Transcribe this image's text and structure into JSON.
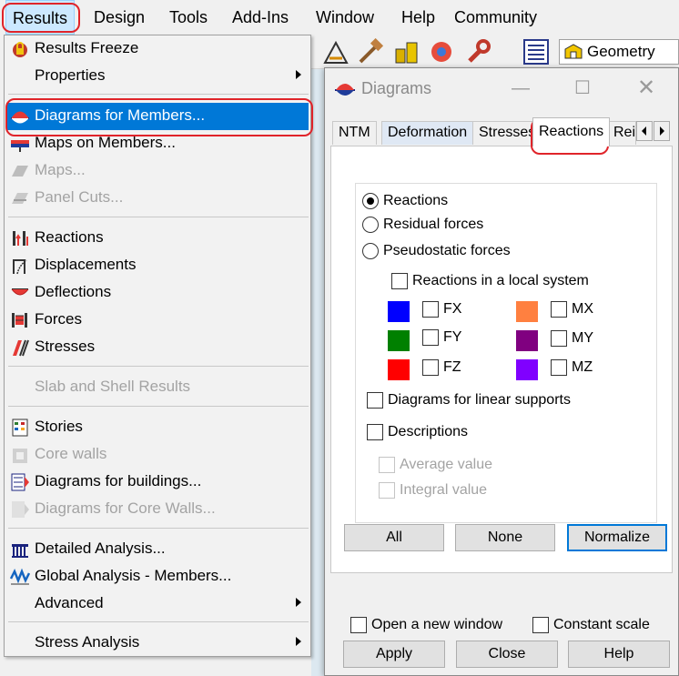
{
  "menubar": {
    "items": [
      "Results",
      "Design",
      "Tools",
      "Add-Ins",
      "Window",
      "Help",
      "Community"
    ]
  },
  "toolbar": {
    "geometry_label": "Geometry"
  },
  "results_menu": {
    "items": [
      {
        "label": "Results Freeze",
        "icon": "lock-icon",
        "enabled": true
      },
      {
        "label": "Properties",
        "icon": "",
        "enabled": true,
        "submenu": true
      },
      {
        "label": "Diagrams for Members...",
        "icon": "member-diagram-icon",
        "enabled": true,
        "selected": true
      },
      {
        "label": "Maps on Members...",
        "icon": "member-map-icon",
        "enabled": true
      },
      {
        "label": "Maps...",
        "icon": "map-icon",
        "enabled": false
      },
      {
        "label": "Panel Cuts...",
        "icon": "panel-cut-icon",
        "enabled": false
      },
      {
        "label": "Reactions",
        "icon": "reactions-icon",
        "enabled": true
      },
      {
        "label": "Displacements",
        "icon": "displacements-icon",
        "enabled": true
      },
      {
        "label": "Deflections",
        "icon": "deflections-icon",
        "enabled": true
      },
      {
        "label": "Forces",
        "icon": "forces-icon",
        "enabled": true
      },
      {
        "label": "Stresses",
        "icon": "stresses-icon",
        "enabled": true
      },
      {
        "label": "Slab and Shell Results",
        "icon": "slab-shell-icon",
        "enabled": false
      },
      {
        "label": "Stories",
        "icon": "stories-icon",
        "enabled": true
      },
      {
        "label": "Core walls",
        "icon": "core-walls-icon",
        "enabled": false
      },
      {
        "label": "Diagrams for buildings...",
        "icon": "building-diagram-icon",
        "enabled": true
      },
      {
        "label": "Diagrams for Core Walls...",
        "icon": "core-wall-diagram-icon",
        "enabled": false
      },
      {
        "label": "Detailed Analysis...",
        "icon": "detailed-analysis-icon",
        "enabled": true
      },
      {
        "label": "Global Analysis - Members...",
        "icon": "global-analysis-icon",
        "enabled": true
      },
      {
        "label": "Advanced",
        "icon": "",
        "enabled": true,
        "submenu": true
      },
      {
        "label": "Stress Analysis",
        "icon": "",
        "enabled": true,
        "submenu": true
      }
    ]
  },
  "dialog": {
    "title": "Diagrams",
    "tabs": [
      "NTM",
      "Deformation",
      "Stresses",
      "Reactions",
      "Rei"
    ],
    "active_tab": "Reactions",
    "radios": [
      {
        "label": "Reactions",
        "checked": true
      },
      {
        "label": "Residual forces",
        "checked": false
      },
      {
        "label": "Pseudostatic forces",
        "checked": false
      }
    ],
    "local_system_label": "Reactions in a local system",
    "components": [
      {
        "label": "FX",
        "color": "#0000ff",
        "checked": false
      },
      {
        "label": "FY",
        "color": "#008000",
        "checked": false
      },
      {
        "label": "FZ",
        "color": "#ff0000",
        "checked": false
      },
      {
        "label": "MX",
        "color": "#ff8040",
        "checked": false
      },
      {
        "label": "MY",
        "color": "#800080",
        "checked": false
      },
      {
        "label": "MZ",
        "color": "#8000ff",
        "checked": false
      }
    ],
    "linear_supports_label": "Diagrams for linear supports",
    "descriptions_label": "Descriptions",
    "average_value_label": "Average value",
    "integral_value_label": "Integral value",
    "buttons": {
      "all": "All",
      "none": "None",
      "normalize": "Normalize"
    },
    "open_new_window_label": "Open a new window",
    "constant_scale_label": "Constant scale",
    "footer_buttons": {
      "apply": "Apply",
      "close": "Close",
      "help": "Help"
    }
  }
}
